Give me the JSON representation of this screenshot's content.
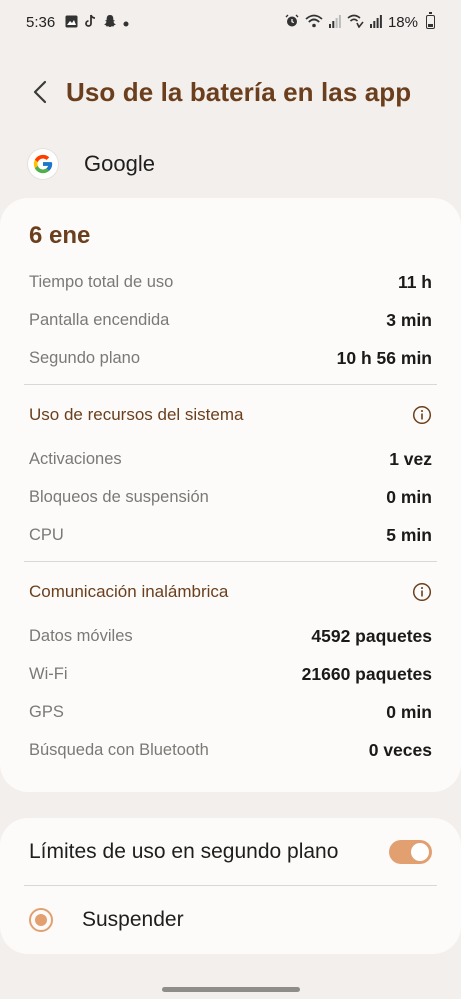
{
  "status_bar": {
    "time": "5:36",
    "battery_pct": "18%",
    "left_icons": [
      "gallery-icon",
      "tiktok-icon",
      "snapchat-icon",
      "dot-icon"
    ],
    "right_icons": [
      "alarm-icon",
      "wifi-icon",
      "signal-icon",
      "wifi-call-icon",
      "signal-icon-2",
      "battery-icon"
    ]
  },
  "header": {
    "title": "Uso de la batería en las app"
  },
  "app": {
    "name": "Google",
    "icon": "google-g-icon"
  },
  "stats": {
    "date": "6 ene",
    "usage": [
      {
        "label": "Tiempo total de uso",
        "value": "11 h"
      },
      {
        "label": "Pantalla encendida",
        "value": "3 min"
      },
      {
        "label": "Segundo plano",
        "value": "10 h 56 min"
      }
    ],
    "system_section": {
      "title": "Uso de recursos del sistema",
      "rows": [
        {
          "label": "Activaciones",
          "value": "1 vez"
        },
        {
          "label": "Bloqueos de suspensión",
          "value": "0 min"
        },
        {
          "label": "CPU",
          "value": "5 min"
        }
      ]
    },
    "wireless_section": {
      "title": "Comunicación inalámbrica",
      "rows": [
        {
          "label": "Datos móviles",
          "value": "4592 paquetes"
        },
        {
          "label": "Wi-Fi",
          "value": "21660 paquetes"
        },
        {
          "label": "GPS",
          "value": "0 min"
        },
        {
          "label": "Búsqueda con Bluetooth",
          "value": "0 veces"
        }
      ]
    }
  },
  "limits": {
    "label": "Límites de uso en segundo plano",
    "toggle_on": true,
    "option_label": "Suspender",
    "option_selected": true
  },
  "colors": {
    "accent": "#e2a071",
    "title_brown": "#6b3f1d",
    "background": "#f3efec",
    "card": "#fcfbfa"
  }
}
